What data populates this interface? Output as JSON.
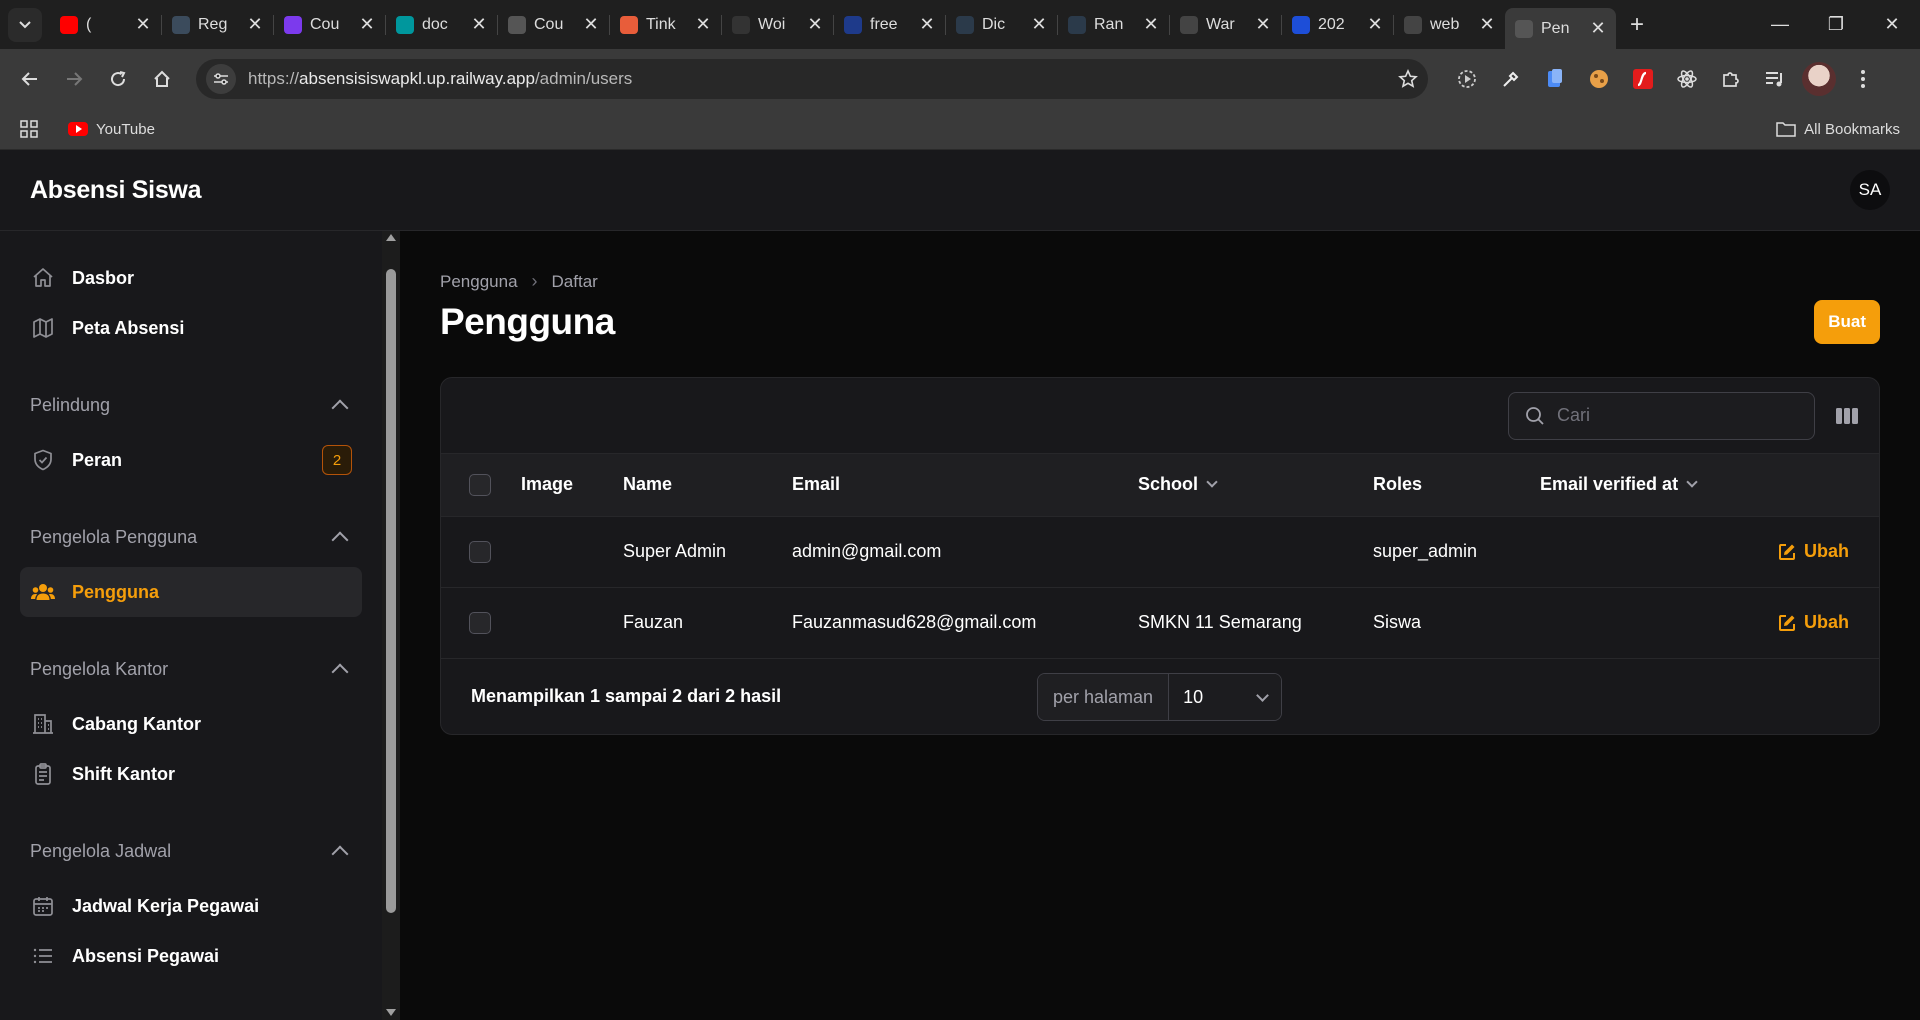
{
  "browser": {
    "tabs": [
      {
        "title": "(",
        "color": "#ff0000"
      },
      {
        "title": "Reg",
        "color": "#3b4b5c"
      },
      {
        "title": "Cou",
        "color": "#7c3aed"
      },
      {
        "title": "doc",
        "color": "#00979d"
      },
      {
        "title": "Cou",
        "color": "#555555"
      },
      {
        "title": "Tink",
        "color": "#e85d3a"
      },
      {
        "title": "Woi",
        "color": "#333333"
      },
      {
        "title": "free",
        "color": "#1e3a8a"
      },
      {
        "title": "Dic",
        "color": "#2b3a4a"
      },
      {
        "title": "Ran",
        "color": "#2b3a4a"
      },
      {
        "title": "War",
        "color": "#444444"
      },
      {
        "title": "202",
        "color": "#1d4ed8"
      },
      {
        "title": "web",
        "color": "#444444"
      },
      {
        "title": "Pen",
        "color": "#555555"
      }
    ],
    "url_prefix": "https://",
    "url_host": "absensisiswapkl.up.railway.app",
    "url_path": "/admin/users",
    "bookmark_youtube": "YouTube",
    "all_bookmarks": "All Bookmarks"
  },
  "app": {
    "brand": "Absensi Siswa",
    "user_initials": "SA"
  },
  "sidebar": {
    "top_items": [
      {
        "label": "Dasbor",
        "icon": "home-icon"
      },
      {
        "label": "Peta Absensi",
        "icon": "map-icon"
      }
    ],
    "groups": [
      {
        "label": "Pelindung",
        "items": [
          {
            "label": "Peran",
            "icon": "shield-check-icon",
            "badge": "2"
          }
        ]
      },
      {
        "label": "Pengelola Pengguna",
        "items": [
          {
            "label": "Pengguna",
            "icon": "users-icon",
            "active": true
          }
        ]
      },
      {
        "label": "Pengelola Kantor",
        "items": [
          {
            "label": "Cabang Kantor",
            "icon": "building-icon"
          },
          {
            "label": "Shift Kantor",
            "icon": "clipboard-icon"
          }
        ]
      },
      {
        "label": "Pengelola Jadwal",
        "items": [
          {
            "label": "Jadwal Kerja Pegawai",
            "icon": "calendar-icon"
          },
          {
            "label": "Absensi Pegawai",
            "icon": "list-icon"
          }
        ]
      }
    ]
  },
  "main": {
    "breadcrumb": [
      "Pengguna",
      "Daftar"
    ],
    "title": "Pengguna",
    "create_label": "Buat",
    "search_placeholder": "Cari",
    "columns": [
      "Image",
      "Name",
      "Email",
      "School",
      "Roles",
      "Email verified at"
    ],
    "rows": [
      {
        "image": "",
        "name": "Super Admin",
        "email": "admin@gmail.com",
        "school": "",
        "roles": "super_admin",
        "verified": "",
        "action": "Ubah"
      },
      {
        "image": "",
        "name": "Fauzan",
        "email": "Fauzanmasud628@gmail.com",
        "school": "SMKN 11 Semarang",
        "roles": "Siswa",
        "verified": "",
        "action": "Ubah"
      }
    ],
    "footer_text": "Menampilkan 1 sampai 2 dari 2 hasil",
    "per_page_label": "per halaman",
    "per_page_value": "10"
  },
  "colors": {
    "accent": "#f59e0b",
    "bg": "#0a0a0a",
    "panel": "#18181b"
  }
}
